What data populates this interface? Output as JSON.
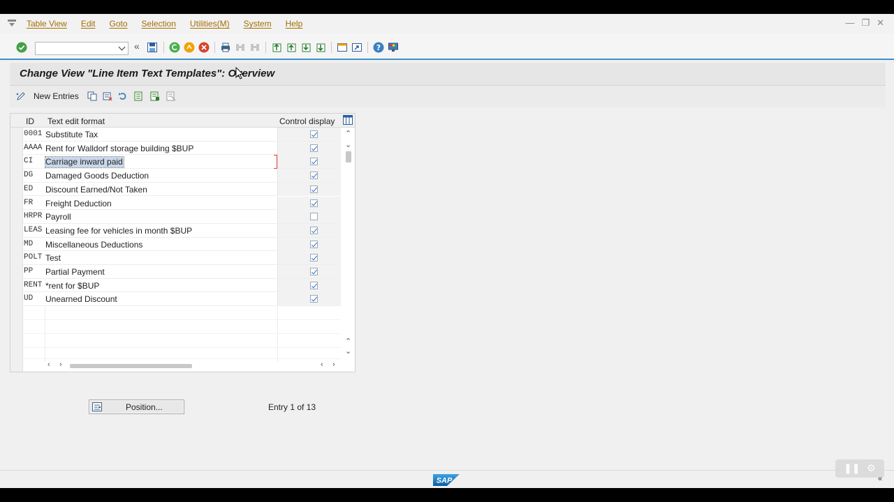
{
  "menubar": {
    "items": [
      "Table View",
      "Edit",
      "Goto",
      "Selection",
      "Utilities(M)",
      "System",
      "Help"
    ]
  },
  "title": "Change View \"Line Item Text Templates\": Overview",
  "app_toolbar": {
    "new_entries_label": "New Entries"
  },
  "table": {
    "headers": {
      "id": "ID",
      "text": "Text edit format",
      "control": "Control display"
    },
    "rows": [
      {
        "id": "0001",
        "text": "Substitute Tax",
        "control": true
      },
      {
        "id": "AAAA",
        "text": "Rent for Walldorf storage building $BUP",
        "control": true
      },
      {
        "id": "CI",
        "text": "Carriage inward paid",
        "control": true,
        "selected": true
      },
      {
        "id": "DG",
        "text": "Damaged Goods Deduction",
        "control": true
      },
      {
        "id": "ED",
        "text": "Discount Earned/Not Taken",
        "control": true
      },
      {
        "id": "FR",
        "text": "Freight Deduction",
        "control": true
      },
      {
        "id": "HRPR",
        "text": "Payroll",
        "control": false
      },
      {
        "id": "LEAS",
        "text": "Leasing fee for vehicles in month $BUP",
        "control": true
      },
      {
        "id": "MD",
        "text": "Miscellaneous Deductions",
        "control": true
      },
      {
        "id": "POLT",
        "text": "Test",
        "control": true
      },
      {
        "id": "PP",
        "text": "Partial Payment",
        "control": true
      },
      {
        "id": "RENT",
        "text": "*rent for $BUP",
        "control": true
      },
      {
        "id": "UD",
        "text": "Unearned Discount",
        "control": true
      }
    ]
  },
  "position_button": "Position...",
  "entry_text": "Entry 1 of 13",
  "logo": "SAP",
  "colors": {
    "menu": "#a36b00",
    "accent": "#3a8fc9",
    "check": "#2a6ebd",
    "selection": "#c8d8ea"
  }
}
